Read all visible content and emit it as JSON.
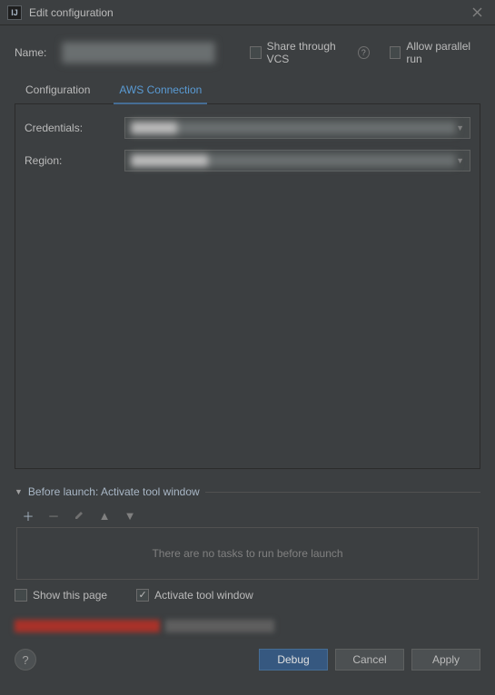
{
  "window": {
    "title": "Edit configuration",
    "appIconGlyph": "IJ"
  },
  "name": {
    "label": "Name:",
    "value": "████████████"
  },
  "options": {
    "shareVcsLabel": "Share through VCS",
    "allowParallelLabel": "Allow parallel run"
  },
  "tabs": {
    "configuration": "Configuration",
    "aws": "AWS Connection"
  },
  "form": {
    "credentialsLabel": "Credentials:",
    "credentialsValue": "██████",
    "regionLabel": "Region:",
    "regionValue": "██████████"
  },
  "beforeLaunch": {
    "title": "Before launch: Activate tool window",
    "emptyText": "There are no tasks to run before launch",
    "showPageLabel": "Show this page",
    "activateToolLabel": "Activate tool window"
  },
  "buttons": {
    "debug": "Debug",
    "cancel": "Cancel",
    "apply": "Apply"
  }
}
